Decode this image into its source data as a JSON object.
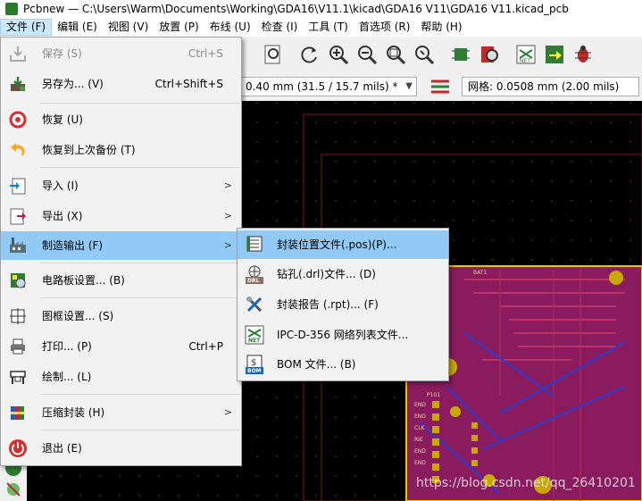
{
  "window": {
    "title": "Pcbnew — C:\\Users\\Warm\\Documents\\Working\\GDA16\\V11.1\\kicad\\GDA16 V11\\GDA16 V11.kicad_pcb"
  },
  "menubar": [
    {
      "label": "文件 (F)"
    },
    {
      "label": "编辑 (E)"
    },
    {
      "label": "视图 (V)"
    },
    {
      "label": "放置 (P)"
    },
    {
      "label": "布线 (U)"
    },
    {
      "label": "检查 (I)"
    },
    {
      "label": "工具 (T)"
    },
    {
      "label": "首选项 (R)"
    },
    {
      "label": "帮助 (H)"
    }
  ],
  "toolbar": {
    "track_width": "0.40 mm (31.5 / 15.7 mils) *",
    "grid": "网格: 0.0508 mm (2.00 mils)"
  },
  "file_menu": {
    "items": [
      {
        "label": "保存 (S)",
        "shortcut": "Ctrl+S",
        "icon": "save-icon"
      },
      {
        "label": "另存为... (V)",
        "shortcut": "Ctrl+Shift+S",
        "icon": "save-as-icon"
      },
      {
        "label": "恢复 (U)",
        "icon": "revert-icon"
      },
      {
        "label": "恢复到上次备份 (T)",
        "icon": "undo-backup-icon"
      },
      {
        "label": "导入 (I)",
        "icon": "import-icon"
      },
      {
        "label": "导出 (X)",
        "icon": "export-icon"
      },
      {
        "label": "制造输出 (F)",
        "icon": "factory-icon"
      },
      {
        "label": "电路板设置... (B)",
        "icon": "board-setup-icon"
      },
      {
        "label": "图框设置... (S)",
        "icon": "page-setup-icon"
      },
      {
        "label": "打印... (P)",
        "shortcut": "Ctrl+P",
        "icon": "print-icon"
      },
      {
        "label": "绘制... (L)",
        "icon": "plot-icon"
      },
      {
        "label": "压缩封装 (H)",
        "icon": "archive-icon"
      },
      {
        "label": "退出 (E)",
        "icon": "exit-icon"
      }
    ]
  },
  "fab_submenu": {
    "items": [
      {
        "label": "封装位置文件(.pos)(P)...",
        "icon": "pos-file-icon"
      },
      {
        "label": "钻孔(.drl)文件... (D)",
        "icon": "drill-file-icon",
        "badge": "DRL"
      },
      {
        "label": "封装报告 (.rpt)... (F)",
        "icon": "footprint-report-icon"
      },
      {
        "label": "IPC-D-356 网络列表文件...",
        "icon": "netlist-icon",
        "badge": "NET"
      },
      {
        "label": "BOM 文件... (B)",
        "icon": "bom-icon",
        "badge": "BOM"
      }
    ]
  },
  "canvas": {
    "labels": [
      "BAT1",
      "P101",
      "END",
      "END",
      "CLK",
      "RIE",
      "END",
      "END"
    ]
  },
  "watermark": "https://blog.csdn.net/qq_26410201",
  "colors": {
    "board": "#8a1b5e",
    "highlight": "#91c9f7",
    "menu_bg": "#f2f2f2"
  }
}
